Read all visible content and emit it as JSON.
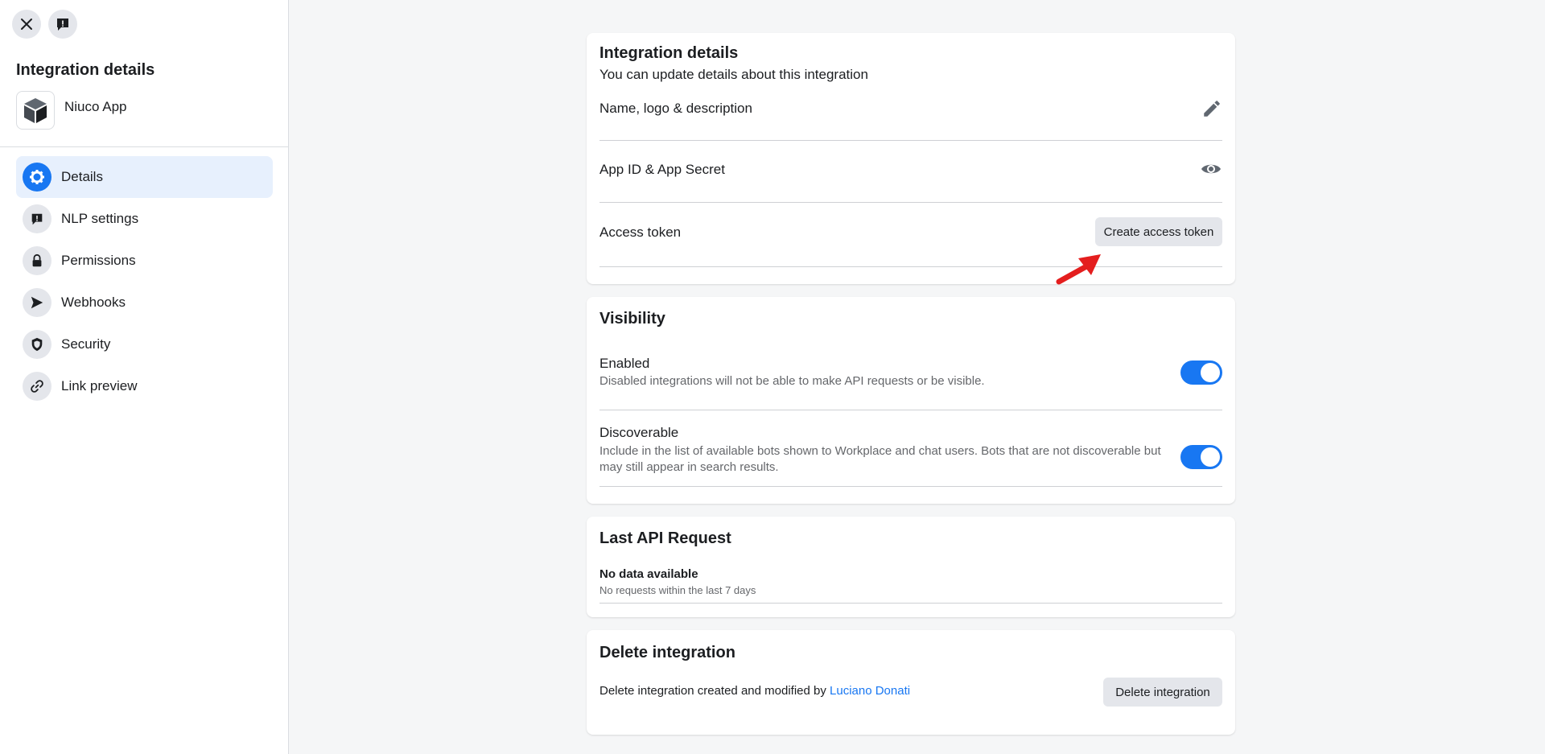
{
  "sidebar": {
    "title": "Integration details",
    "app_name": "Niuco App",
    "items": [
      {
        "label": "Details",
        "icon": "gear-icon"
      },
      {
        "label": "NLP settings",
        "icon": "speech-bubble-icon"
      },
      {
        "label": "Permissions",
        "icon": "lock-icon"
      },
      {
        "label": "Webhooks",
        "icon": "send-icon"
      },
      {
        "label": "Security",
        "icon": "shield-icon"
      },
      {
        "label": "Link preview",
        "icon": "link-icon"
      }
    ]
  },
  "details": {
    "title": "Integration details",
    "subtitle": "You can update details about this integration",
    "name_row": "Name, logo & description",
    "appid_row": "App ID & App Secret",
    "token_row": "Access token",
    "create_token_btn": "Create access token"
  },
  "visibility": {
    "title": "Visibility",
    "enabled_label": "Enabled",
    "enabled_desc": "Disabled integrations will not be able to make API requests or be visible.",
    "enabled_on": true,
    "discoverable_label": "Discoverable",
    "discoverable_desc_1": "Include in the list of available bots shown to Workplace and chat users. Bots that are not discoverable but",
    "discoverable_desc_2": "may still appear in search results.",
    "discoverable_on": true
  },
  "api": {
    "title": "Last API Request",
    "no_data": "No data available",
    "no_requests": "No requests within the last 7 days"
  },
  "delete": {
    "title": "Delete integration",
    "text": "Delete integration created and modified by",
    "author": "Luciano Donati",
    "button": "Delete integration"
  },
  "colors": {
    "accent": "#1877f2",
    "arrow": "#e41e1e"
  }
}
